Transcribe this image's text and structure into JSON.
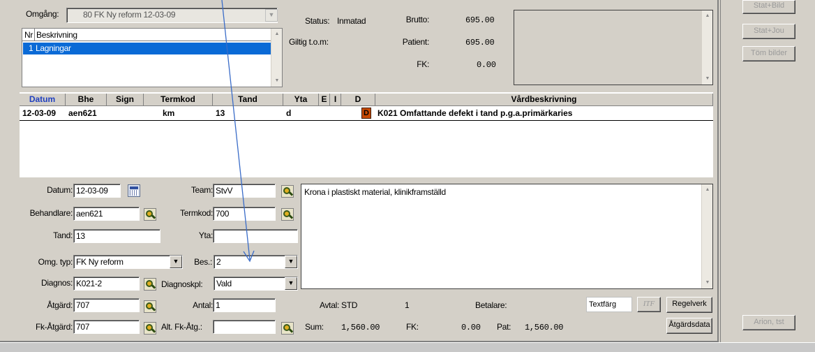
{
  "header": {
    "omgang_label": "Omgång:",
    "omgang_value": "80 FK Ny reform  12-03-09",
    "status_label": "Status:",
    "status_value": "Inmatad",
    "giltig_label": "Giltig t.o.m:",
    "brutto_label": "Brutto:",
    "brutto_value": "695.00",
    "patient_label": "Patient:",
    "patient_value": "695.00",
    "fk_label": "FK:",
    "fk_value": "0.00"
  },
  "besk_list": {
    "col_nr": "Nr",
    "col_besk": "Beskrivning",
    "rows": [
      {
        "nr": "1",
        "text": "Lagningar"
      }
    ]
  },
  "side_buttons": {
    "stat_bild": "Stat+Bild",
    "stat_jou": "Stat+Jou",
    "tom_bilder": "Töm bilder",
    "arion": "Arion, tst"
  },
  "grid": {
    "headers": [
      "Datum",
      "Bhe",
      "Sign",
      "Termkod",
      "Tand",
      "Yta",
      "E",
      "I",
      "D",
      "Vårdbeskrivning"
    ],
    "rows": [
      {
        "datum": "12-03-09",
        "bhe": "aen621",
        "sign": "",
        "termkod": "km",
        "tand": "13",
        "yta": "d",
        "e": "",
        "i": "",
        "d": "D",
        "beskrivning": "K021 Omfattande defekt i tand p.g.a.primärkaries"
      }
    ]
  },
  "form": {
    "datum_label": "Datum:",
    "datum_value": "12-03-09",
    "team_label": "Team:",
    "team_value": "StvV",
    "behandlare_label": "Behandlare:",
    "behandlare_value": "aen621",
    "termkod_label": "Termkod:",
    "termkod_value": "700",
    "tand_label": "Tand:",
    "tand_value": "13",
    "yta_label": "Yta:",
    "yta_value": "",
    "omgtyp_label": "Omg. typ:",
    "omgtyp_value": "FK Ny reform",
    "bes_label": "Bes.:",
    "bes_value": "2",
    "diagnos_label": "Diagnos:",
    "diagnos_value": "K021-2",
    "diagnoskpl_label": "Diagnoskpl:",
    "diagnoskpl_value": "Vald",
    "atgard_label": "Åtgärd:",
    "atgard_value": "707",
    "antal_label": "Antal:",
    "antal_value": "1",
    "fkatgard_label": "Fk-Åtgärd:",
    "fkatgard_value": "707",
    "altfk_label": "Alt. Fk-Åtg.:",
    "altfk_value": "",
    "note_text": "Krona i plastiskt material, klinikframställd"
  },
  "footer": {
    "avtal_label": "Avtal: STD",
    "avtal_count": "1",
    "betalare_label": "Betalare:",
    "sum_label": "Sum:",
    "sum_value": "1,560.00",
    "fk_label": "FK:",
    "fk_value": "0.00",
    "pat_label": "Pat:",
    "pat_value": "1,560.00",
    "textfarg": "Textfärg",
    "itf": "ITF",
    "regelverk": "Regelverk",
    "atgardsdata": "Åtgärdsdata"
  },
  "colors": {
    "selection": "#0a6ad6",
    "link_header": "#1f3fbf",
    "d_marker": "#c84a00",
    "arrow": "#3a6cc8"
  }
}
